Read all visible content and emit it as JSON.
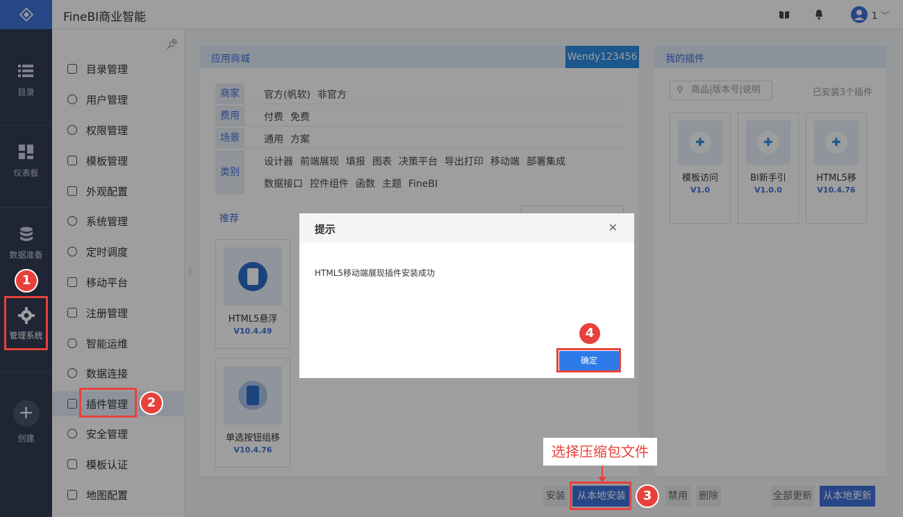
{
  "header": {
    "title": "FineBI商业智能",
    "user_number": "1"
  },
  "rail": {
    "items": [
      {
        "label": "目录"
      },
      {
        "label": "仪表板"
      },
      {
        "label": "数据准备"
      },
      {
        "label": "管理系统"
      },
      {
        "label": "创建"
      }
    ]
  },
  "menu": {
    "items": [
      {
        "label": "目录管理"
      },
      {
        "label": "用户管理"
      },
      {
        "label": "权限管理"
      },
      {
        "label": "模板管理"
      },
      {
        "label": "外观配置"
      },
      {
        "label": "系统管理"
      },
      {
        "label": "定时调度"
      },
      {
        "label": "移动平台"
      },
      {
        "label": "注册管理"
      },
      {
        "label": "智能运维"
      },
      {
        "label": "数据连接"
      },
      {
        "label": "插件管理"
      },
      {
        "label": "安全管理"
      },
      {
        "label": "模板认证"
      },
      {
        "label": "地图配置"
      }
    ]
  },
  "store": {
    "title": "应用商城",
    "user_tag": "Wendy123456",
    "filters": {
      "vendor": {
        "label": "商家",
        "options": [
          "官方(帆软)",
          "非官方"
        ]
      },
      "fee": {
        "label": "费用",
        "options": [
          "付费",
          "免费"
        ]
      },
      "scene": {
        "label": "场景",
        "options": [
          "通用",
          "方案"
        ]
      },
      "category": {
        "label": "类别",
        "row1": [
          "设计器",
          "前端展现",
          "填报",
          "图表",
          "决策平台",
          "导出打印",
          "移动端",
          "部署集成"
        ],
        "row2": [
          "数据接口",
          "控件组件",
          "函数",
          "主题",
          "FineBI"
        ]
      }
    },
    "recommend_label": "推荐",
    "cards": [
      {
        "name": "HTML5悬浮",
        "version": "V10.4.49"
      },
      {
        "name": "单选按钮组移",
        "version": "V10.4.76"
      }
    ],
    "buttons": {
      "install": "安装",
      "install_local": "从本地安装",
      "disable": "禁用",
      "delete": "删除",
      "update_all": "全部更新",
      "update_local": "从本地更新"
    }
  },
  "mine": {
    "title": "我的插件",
    "search_placeholder": "商品|版本号|说明",
    "installed_text": "已安装3个插件",
    "cards": [
      {
        "name": "模板访问",
        "version": "V1.0"
      },
      {
        "name": "BI新手引",
        "version": "V1.0.0"
      },
      {
        "name": "HTML5移",
        "version": "V10.4.76"
      }
    ]
  },
  "dialog": {
    "title": "提示",
    "message": "HTML5移动端展现插件安装成功",
    "ok_label": "确定"
  },
  "annotations": {
    "badges": [
      "1",
      "2",
      "3",
      "4"
    ],
    "callout": "选择压缩包文件"
  },
  "colors": {
    "accent": "#3f72d9",
    "rail": "#323d55",
    "annotation": "#e8413b"
  }
}
